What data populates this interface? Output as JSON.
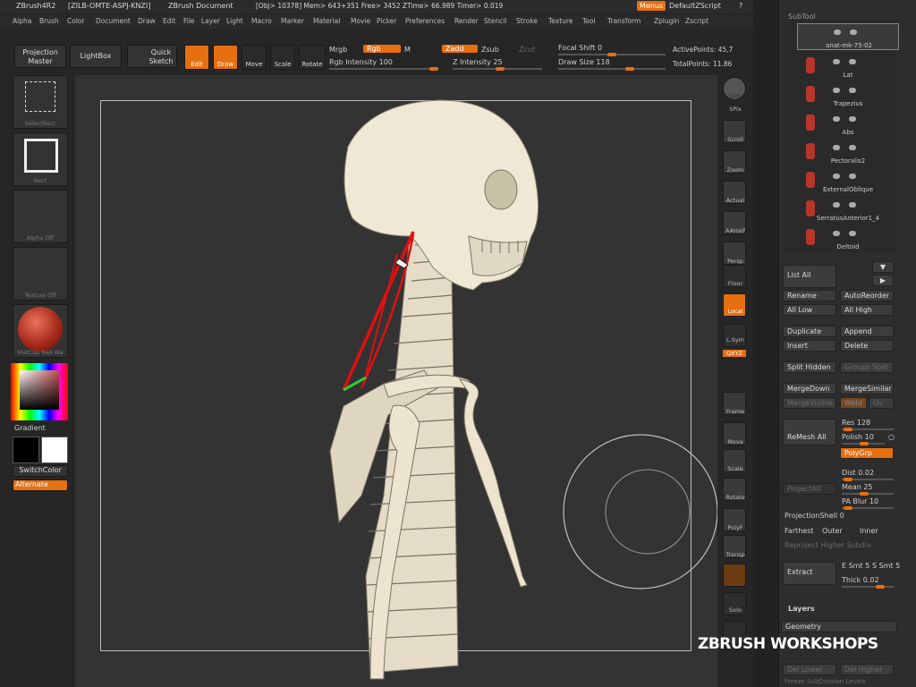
{
  "titlebar": {
    "app": "ZBrush4R2",
    "key": "[ZILB-OMTE-ASPJ-KNZI]",
    "doc": "ZBrush Document",
    "stats": "[Obj> 10378] Mem> 643+351  Free> 3452  ZTime> 66.989  Timer> 0.019",
    "menus": "Menus",
    "script": "DefaultZScript"
  },
  "menu": [
    "Alpha",
    "Brush",
    "Color",
    "Document",
    "Draw",
    "Edit",
    "File",
    "Layer",
    "Light",
    "Macro",
    "Marker",
    "Material",
    "Movie",
    "Picker",
    "Preferences",
    "Render",
    "Stencil",
    "Stroke",
    "Texture",
    "Tool",
    "Transform",
    "Zplugin",
    "Zscript"
  ],
  "shelf": {
    "projection_master": "Projection Master",
    "lightbox": "LightBox",
    "quick_sketch": "Quick Sketch",
    "edit": "Edit",
    "draw": "Draw",
    "move": "Move",
    "scale": "Scale",
    "rotate": "Rotate",
    "mrgb": "Mrgb",
    "rgb": "Rgb",
    "m": "M",
    "rgb_intensity": "Rgb Intensity 100",
    "zadd": "Zadd",
    "zsub": "Zsub",
    "zcut": "Zcut",
    "z_intensity": "Z Intensity 25",
    "focal_shift": "Focal Shift 0",
    "draw_size": "Draw Size 118",
    "active_points": "ActivePoints: 45,7",
    "total_points": "TotalPoints: 11.86"
  },
  "left": {
    "stroke_label": "SelectRect",
    "brush_label": "Rect",
    "alpha_label": "Alpha Off",
    "texture_label": "Texture Off",
    "material_label": "MatCap Red Wa",
    "gradient": "Gradient",
    "switchcolor": "SwitchColor",
    "alternate": "Alternate"
  },
  "right": {
    "bpr": "BPR",
    "spix": "SPix",
    "scroll": "Scroll",
    "zoom": "Zoom",
    "actual": "Actual",
    "aahalf": "AAHalf",
    "persp": "Persp",
    "floor": "Floor",
    "local": "Local",
    "lsym": "L.Sym",
    "xyz": "QXYZ",
    "frame": "Frame",
    "move": "Move",
    "scale": "Scale",
    "rotate": "Rotate",
    "polyf": "PolyF",
    "transp": "Transp",
    "solo": "Solo"
  },
  "subtool": {
    "header": "SubTool",
    "items": [
      "anat-mk-75-02",
      "Lat",
      "Trapezius",
      "Abs",
      "Pectoralis2",
      "ExternalOblique",
      "SerratusAnterior1_4",
      "Deltoid"
    ],
    "list_all": "List All",
    "rename": "Rename",
    "auto_reorder": "AutoReorder",
    "all_low": "All Low",
    "all_high": "All High",
    "duplicate": "Duplicate",
    "append": "Append",
    "insert": "Insert",
    "delete": "Delete",
    "split_hidden": "Split Hidden",
    "groups_split": "Groups Split",
    "merge_down": "MergeDown",
    "merge_similar": "MergeSimilar",
    "merge_visible": "MergeVisible",
    "weld": "Weld",
    "uv": "Uv",
    "remesh_all": "ReMesh All",
    "res": "Res 128",
    "polish": "Polish 10",
    "polygrp": "PolyGrp",
    "project_all": "ProjectAll",
    "dist": "Dist 0.02",
    "mean": "Mean 25",
    "pa_blur": "PA Blur 10",
    "projection_shell": "ProjectionShell 0",
    "farthest": "Farthest",
    "outer": "Outer",
    "inner": "Inner",
    "reproject": "Reproject Higher Subdiv",
    "extract": "Extract",
    "e_smt": "E Smt 5",
    "s_smt": "S Smt 5",
    "thick": "Thick 0.02",
    "layers": "Layers",
    "geometry": "Geometry",
    "del_lower": "Del Lower",
    "del_higher": "Del Higher",
    "freeze": "Freeze SubDivision Levels"
  },
  "watermark": "ZBRUSH WORKSHOPS",
  "colors": {
    "accent": "#e66f10",
    "bone": "#ede6d2",
    "muscle": "#e01010",
    "highlight": "#2fd22f"
  }
}
